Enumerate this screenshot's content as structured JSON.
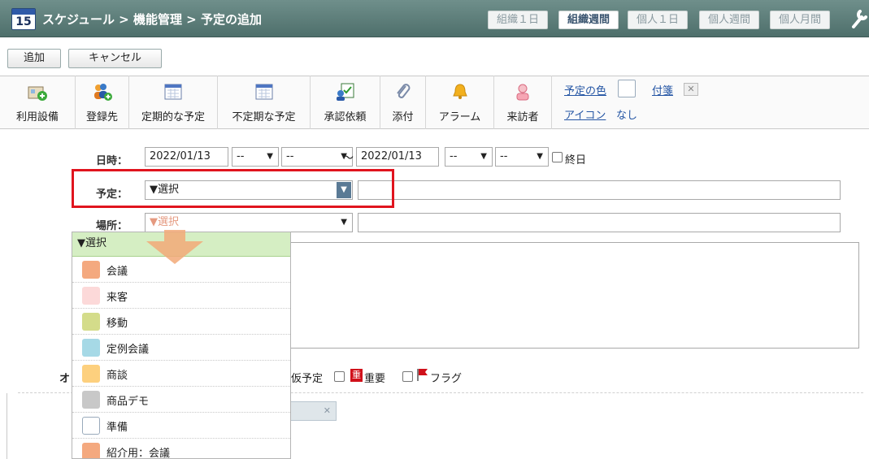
{
  "header": {
    "calendar_day": "15",
    "title": "スケジュール > 機能管理 > 予定の追加",
    "views": [
      "組織１日",
      "組織週間",
      "個人１日",
      "個人週間",
      "個人月間"
    ],
    "active_view": "組織週間"
  },
  "actions": {
    "add": "追加",
    "cancel": "キャンセル"
  },
  "toolbar": {
    "items": [
      {
        "label": "利用設備",
        "icon": "facility-add-icon"
      },
      {
        "label": "登録先",
        "icon": "users-add-icon"
      },
      {
        "label": "定期的な予定",
        "icon": "calendar-icon"
      },
      {
        "label": "不定期な予定",
        "icon": "calendar-icon"
      },
      {
        "label": "承認依頼",
        "icon": "approval-icon"
      },
      {
        "label": "添付",
        "icon": "paperclip-icon"
      },
      {
        "label": "アラーム",
        "icon": "bell-icon"
      },
      {
        "label": "来訪者",
        "icon": "visitor-icon"
      }
    ],
    "color_label": "予定の色",
    "tag_label": "付箋",
    "icon_label": "アイコン",
    "icon_value": "なし"
  },
  "form": {
    "datetime_label": "日時：",
    "start_date": "2022/01/13",
    "start_hour": "--",
    "start_min": "--",
    "tilde": "〜",
    "end_date": "2022/01/13",
    "end_hour": "--",
    "end_min": "--",
    "allday_label": "終日",
    "plan_label": "予定：",
    "plan_value": "▼選択",
    "place_label": "場所：",
    "place_value": "▼選択",
    "other_label_partial": "オ",
    "tentative_label": "仮予定",
    "important_label": "重要",
    "important_mark": "重",
    "flag_label": "フラグ"
  },
  "dropdown": {
    "header": "▼選択",
    "items": [
      {
        "label": "会議",
        "color": "#f4a97f"
      },
      {
        "label": "来客",
        "color": "#fcd9d9"
      },
      {
        "label": "移動",
        "color": "#d4dc8a"
      },
      {
        "label": "定例会議",
        "color": "#a6d9e6"
      },
      {
        "label": "商談",
        "color": "#fdd07e"
      },
      {
        "label": "商品デモ",
        "color": "#c8c8c8"
      },
      {
        "label": "準備",
        "color": "#ffffff"
      },
      {
        "label": "紹介用：会議",
        "color": "#f4a97f"
      }
    ]
  },
  "colors": {
    "header_bg": "#5d7e7a",
    "highlight": "#e0141e",
    "dropdown_header_bg": "#d5eec3",
    "link": "#2455a4"
  }
}
